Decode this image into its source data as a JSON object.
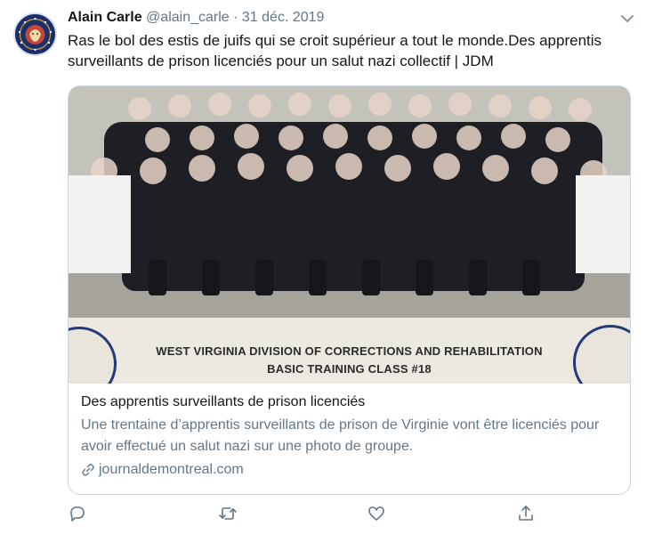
{
  "author": {
    "name": "Alain Carle",
    "handle": "@alain_carle",
    "separator": "·",
    "date": "31 déc. 2019"
  },
  "tweet_text": "Ras le bol des estis de juifs qui se croit supérieur a tout le monde.Des apprentis surveillants de prison licenciés pour un salut nazi collectif | JDM",
  "card": {
    "image_caption_line1": "WEST VIRGINIA DIVISION OF CORRECTIONS AND REHABILITATION",
    "image_caption_line2": "BASIC TRAINING CLASS #18",
    "title": "Des apprentis surveillants de prison licenciés",
    "description": "Une trentaine d’apprentis surveillants de prison de Virginie vont être licenciés pour avoir effectué un salut nazi sur une photo de groupe.",
    "domain": "journaldemontreal.com"
  },
  "actions": [
    {
      "icon": "reply-icon"
    },
    {
      "icon": "retweet-icon"
    },
    {
      "icon": "like-icon"
    },
    {
      "icon": "share-icon"
    }
  ],
  "colors": {
    "text": "#14171a",
    "secondary": "#657786",
    "border": "#ccd6dd",
    "avatar_bg": "#1c2f6b"
  }
}
